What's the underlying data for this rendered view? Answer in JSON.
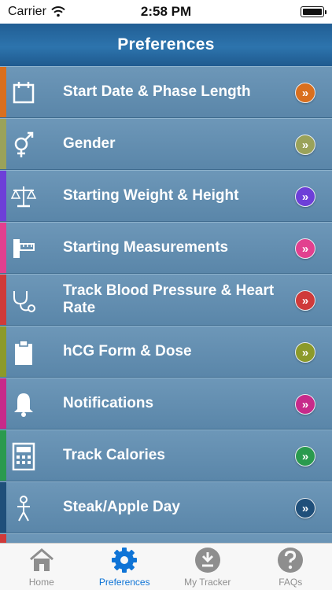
{
  "status": {
    "carrier": "Carrier",
    "time": "2:58 PM"
  },
  "nav": {
    "title": "Preferences"
  },
  "rows": [
    {
      "label": "Start Date & Phase Length",
      "icon": "calendar-icon",
      "color": "#d96f1e"
    },
    {
      "label": "Gender",
      "icon": "gender-icon",
      "color": "#9aa25a"
    },
    {
      "label": "Starting Weight & Height",
      "icon": "scale-icon",
      "color": "#6d3fd8"
    },
    {
      "label": "Starting Measurements",
      "icon": "measuring-tape-icon",
      "color": "#e2408f"
    },
    {
      "label": "Track Blood Pressure & Heart Rate",
      "icon": "stethoscope-icon",
      "color": "#cf3a3a"
    },
    {
      "label": "hCG Form & Dose",
      "icon": "clipboard-icon",
      "color": "#8c9a2a"
    },
    {
      "label": "Notifications",
      "icon": "bell-icon",
      "color": "#c72a8a"
    },
    {
      "label": "Track Calories",
      "icon": "calculator-icon",
      "color": "#2a9a4e"
    },
    {
      "label": "Steak/Apple Day",
      "icon": "person-icon",
      "color": "#1f4f7a"
    }
  ],
  "tabs": [
    {
      "label": "Home",
      "icon": "home-icon",
      "active": false
    },
    {
      "label": "Preferences",
      "icon": "gear-icon",
      "active": true
    },
    {
      "label": "My Tracker",
      "icon": "tracker-icon",
      "active": false
    },
    {
      "label": "FAQs",
      "icon": "question-icon",
      "active": false
    }
  ]
}
